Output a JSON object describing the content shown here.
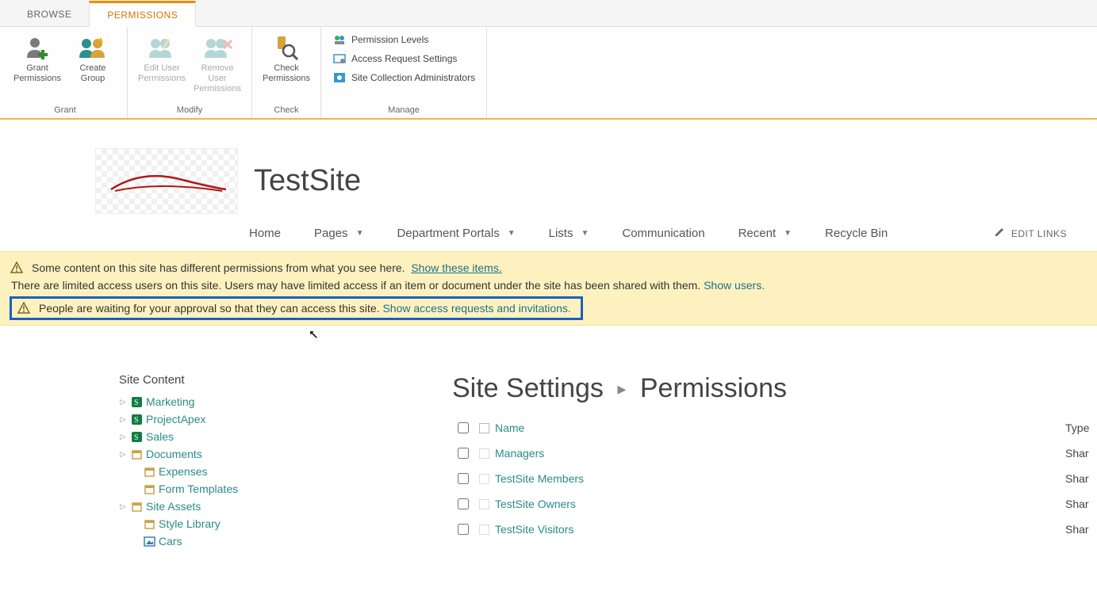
{
  "tabs": {
    "browse": "BROWSE",
    "permissions": "PERMISSIONS"
  },
  "ribbon": {
    "grant": {
      "grant_permissions": "Grant\nPermissions",
      "create_group": "Create\nGroup",
      "label": "Grant"
    },
    "modify": {
      "edit_user": "Edit User\nPermissions",
      "remove_user": "Remove User\nPermissions",
      "label": "Modify"
    },
    "check": {
      "check_permissions": "Check\nPermissions",
      "label": "Check"
    },
    "manage": {
      "permission_levels": "Permission Levels",
      "access_request_settings": "Access Request Settings",
      "site_collection_admins": "Site Collection Administrators",
      "label": "Manage"
    }
  },
  "site": {
    "title": "TestSite"
  },
  "topnav": {
    "home": "Home",
    "pages": "Pages",
    "department_portals": "Department Portals",
    "lists": "Lists",
    "communication": "Communication",
    "recent": "Recent",
    "recycle_bin": "Recycle Bin",
    "edit_links": "EDIT LINKS"
  },
  "notices": {
    "line1_text": "Some content on this site has different permissions from what you see here.",
    "line1_link": "Show these items.",
    "line2_text": "There are limited access users on this site. Users may have limited access if an item or document under the site has been shared with them.",
    "line2_link": "Show users.",
    "line3_text": "People are waiting for your approval so that they can access this site.",
    "line3_link": "Show access requests and invitations."
  },
  "sidebar": {
    "heading": "Site Content",
    "items": [
      {
        "label": "Marketing",
        "icon": "sp-site",
        "expandable": true
      },
      {
        "label": "ProjectApex",
        "icon": "sp-site",
        "expandable": true
      },
      {
        "label": "Sales",
        "icon": "sp-site",
        "expandable": true
      },
      {
        "label": "Documents",
        "icon": "library",
        "expandable": true
      },
      {
        "label": "Expenses",
        "icon": "library",
        "expandable": false
      },
      {
        "label": "Form Templates",
        "icon": "library",
        "expandable": false
      },
      {
        "label": "Site Assets",
        "icon": "library",
        "expandable": true
      },
      {
        "label": "Style Library",
        "icon": "library",
        "expandable": false
      },
      {
        "label": "Cars",
        "icon": "piclib",
        "expandable": false
      }
    ]
  },
  "permissions_page": {
    "breadcrumb_a": "Site Settings",
    "breadcrumb_b": "Permissions",
    "columns": {
      "name": "Name",
      "type": "Type"
    },
    "rows": [
      {
        "name": "Managers",
        "type": "Shar"
      },
      {
        "name": "TestSite Members",
        "type": "Shar"
      },
      {
        "name": "TestSite Owners",
        "type": "Shar"
      },
      {
        "name": "TestSite Visitors",
        "type": "Shar"
      }
    ]
  }
}
